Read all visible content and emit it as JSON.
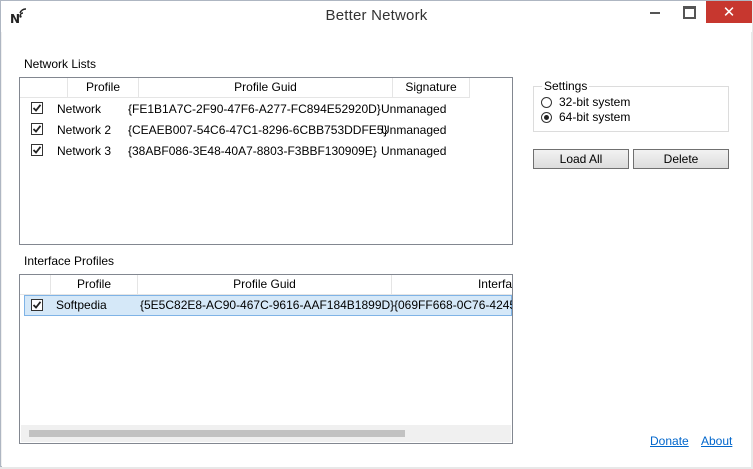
{
  "window": {
    "title": "Better Network",
    "controls": {
      "minimize": "–",
      "maximize": "□",
      "close": "✕"
    }
  },
  "network_lists": {
    "label": "Network Lists",
    "columns": [
      "Profile",
      "Profile Guid",
      "Signature"
    ],
    "rows": [
      {
        "checked": true,
        "profile": "Network",
        "guid": "{FE1B1A7C-2F90-47F6-A277-FC894E52920D}",
        "signature": "Unmanaged"
      },
      {
        "checked": true,
        "profile": "Network  2",
        "guid": "{CEAEB007-54C6-47C1-8296-6CBB753DDFE5}",
        "signature": "Unmanaged"
      },
      {
        "checked": true,
        "profile": "Network  3",
        "guid": "{38ABF086-3E48-40A7-8803-F3BBF130909E}",
        "signature": "Unmanaged"
      }
    ]
  },
  "interface_profiles": {
    "label": "Interface Profiles",
    "columns": [
      "Profile",
      "Profile Guid",
      "Interfa"
    ],
    "rows": [
      {
        "checked": true,
        "profile": "Softpedia",
        "guid": "{5E5C82E8-AC90-467C-9616-AAF184B1899D}",
        "interface": "{069FF668-0C76-4245"
      }
    ]
  },
  "settings": {
    "label": "Settings",
    "options": [
      {
        "label": "32-bit system",
        "selected": false
      },
      {
        "label": "64-bit system",
        "selected": true
      }
    ]
  },
  "buttons": {
    "load_all": "Load All",
    "delete": "Delete"
  },
  "links": {
    "donate": "Donate",
    "about": "About"
  }
}
